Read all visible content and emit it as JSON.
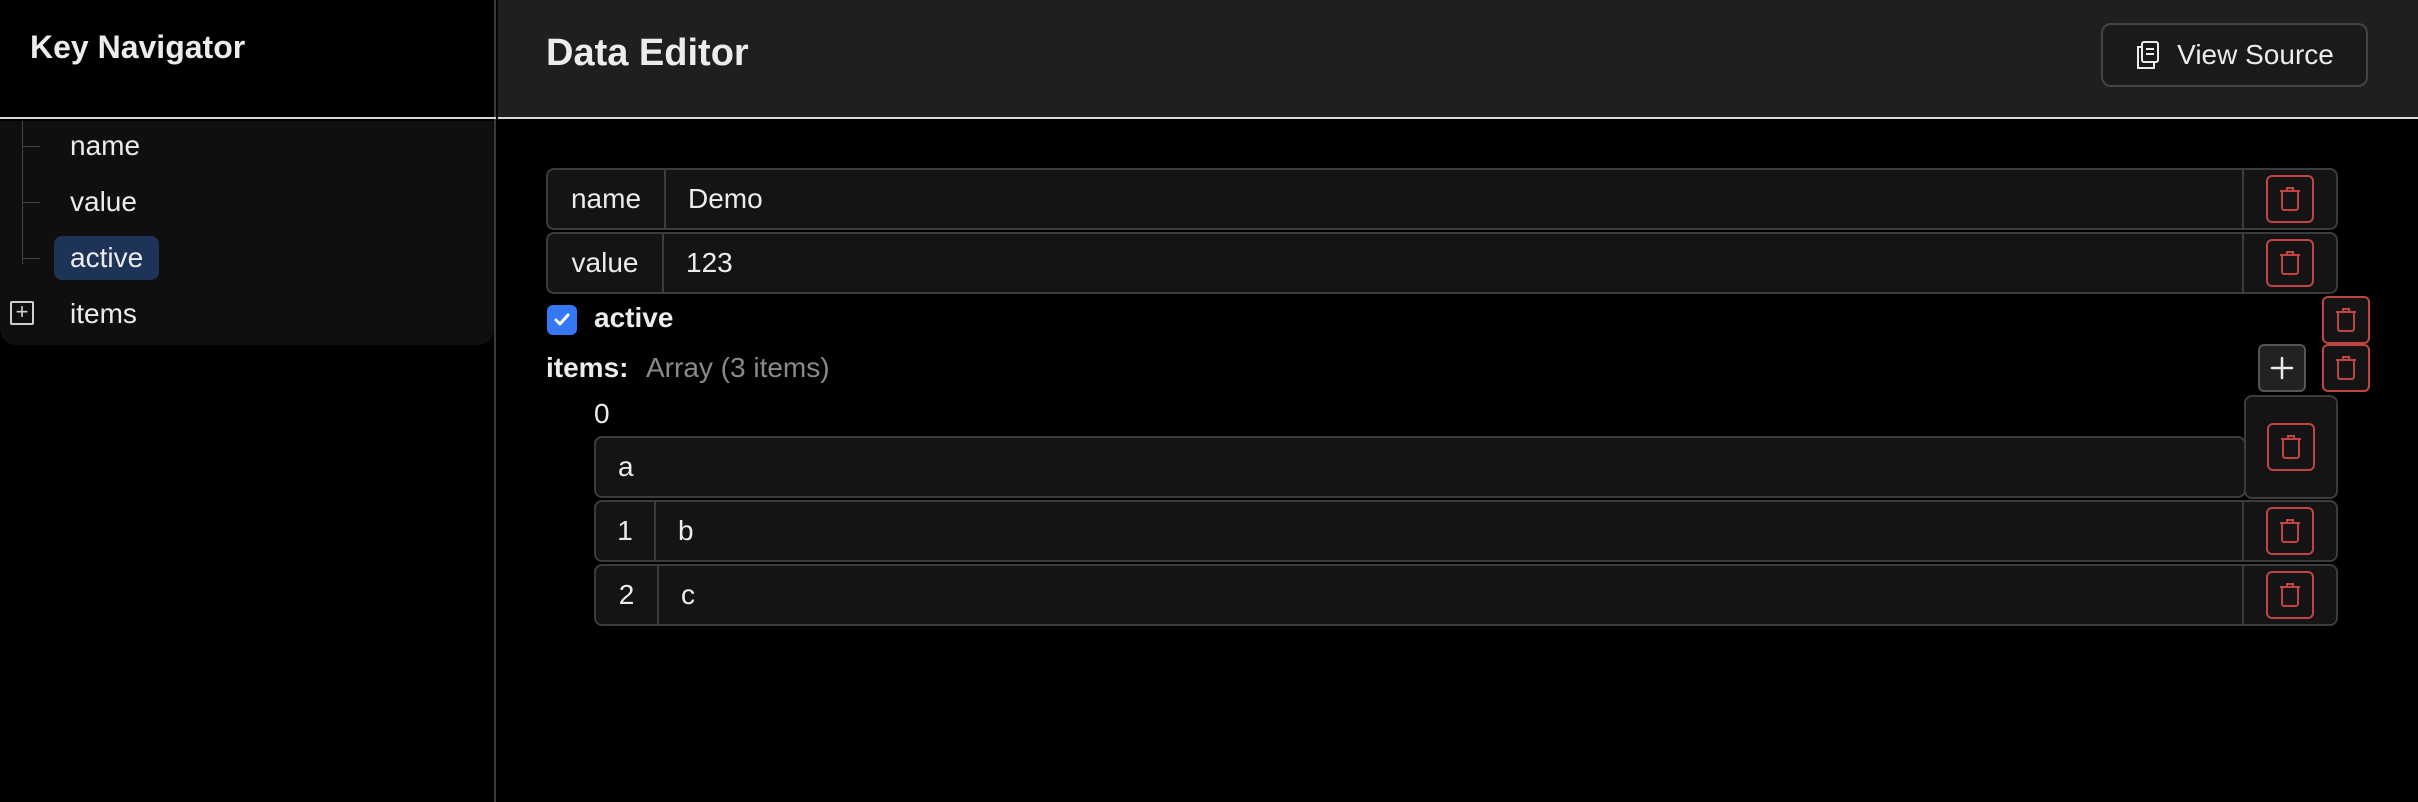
{
  "sidebar": {
    "title": "Key Navigator",
    "items": [
      {
        "label": "name"
      },
      {
        "label": "value"
      },
      {
        "label": "active"
      },
      {
        "label": "items"
      }
    ]
  },
  "header": {
    "title": "Data Editor",
    "view_source_label": "View Source"
  },
  "fields": {
    "name": {
      "key": "name",
      "value": "Demo"
    },
    "value": {
      "key": "value",
      "value": "123"
    },
    "active": {
      "label": "active",
      "checked": true
    },
    "items": {
      "label": "items:",
      "summary": "Array (3 items)",
      "entries": [
        {
          "index": "0",
          "value": "a"
        },
        {
          "index": "1",
          "value": "b"
        },
        {
          "index": "2",
          "value": "c"
        }
      ]
    }
  },
  "colors": {
    "accent": "#3478f6",
    "selected": "#1d3358",
    "danger": "#c04444"
  }
}
